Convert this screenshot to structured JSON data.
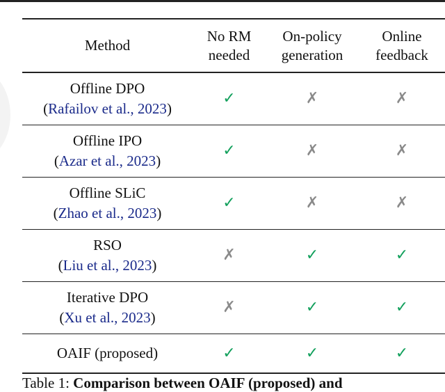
{
  "table": {
    "headers": [
      {
        "lines": [
          "Method"
        ]
      },
      {
        "lines": [
          "No RM",
          "needed"
        ]
      },
      {
        "lines": [
          "On-policy",
          "generation"
        ]
      },
      {
        "lines": [
          "Online",
          "feedback"
        ]
      }
    ],
    "rows": [
      {
        "method": "Offline DPO",
        "citation": {
          "open": "(",
          "text": "Rafailov et al., 2023",
          "close": ")"
        },
        "no_rm_needed": "✓",
        "on_policy_generation": "✗",
        "online_feedback": "✗"
      },
      {
        "method": "Offline IPO",
        "citation": {
          "open": "(",
          "text": "Azar et al., 2023",
          "close": ")"
        },
        "no_rm_needed": "✓",
        "on_policy_generation": "✗",
        "online_feedback": "✗"
      },
      {
        "method": "Offline SLiC",
        "citation": {
          "open": "(",
          "text": "Zhao et al., 2023",
          "close": ")"
        },
        "no_rm_needed": "✓",
        "on_policy_generation": "✗",
        "online_feedback": "✗"
      },
      {
        "method": "RSO",
        "citation": {
          "open": "(",
          "text": "Liu et al., 2023",
          "close": ")"
        },
        "no_rm_needed": "✗",
        "on_policy_generation": "✓",
        "online_feedback": "✓"
      },
      {
        "method": "Iterative DPO",
        "citation": {
          "open": "(",
          "text": "Xu et al., 2023",
          "close": ")"
        },
        "no_rm_needed": "✗",
        "on_policy_generation": "✓",
        "online_feedback": "✓"
      },
      {
        "method": "OAIF (proposed)",
        "no_rm_needed": "✓",
        "on_policy_generation": "✓",
        "online_feedback": "✓"
      }
    ]
  },
  "caption": {
    "label": "Table 1:",
    "bold_text": "Comparison between OAIF (proposed) and"
  },
  "colors": {
    "check": "#12a05c",
    "cross": "#8a8a8a",
    "citation_link": "#1a2a8a"
  }
}
